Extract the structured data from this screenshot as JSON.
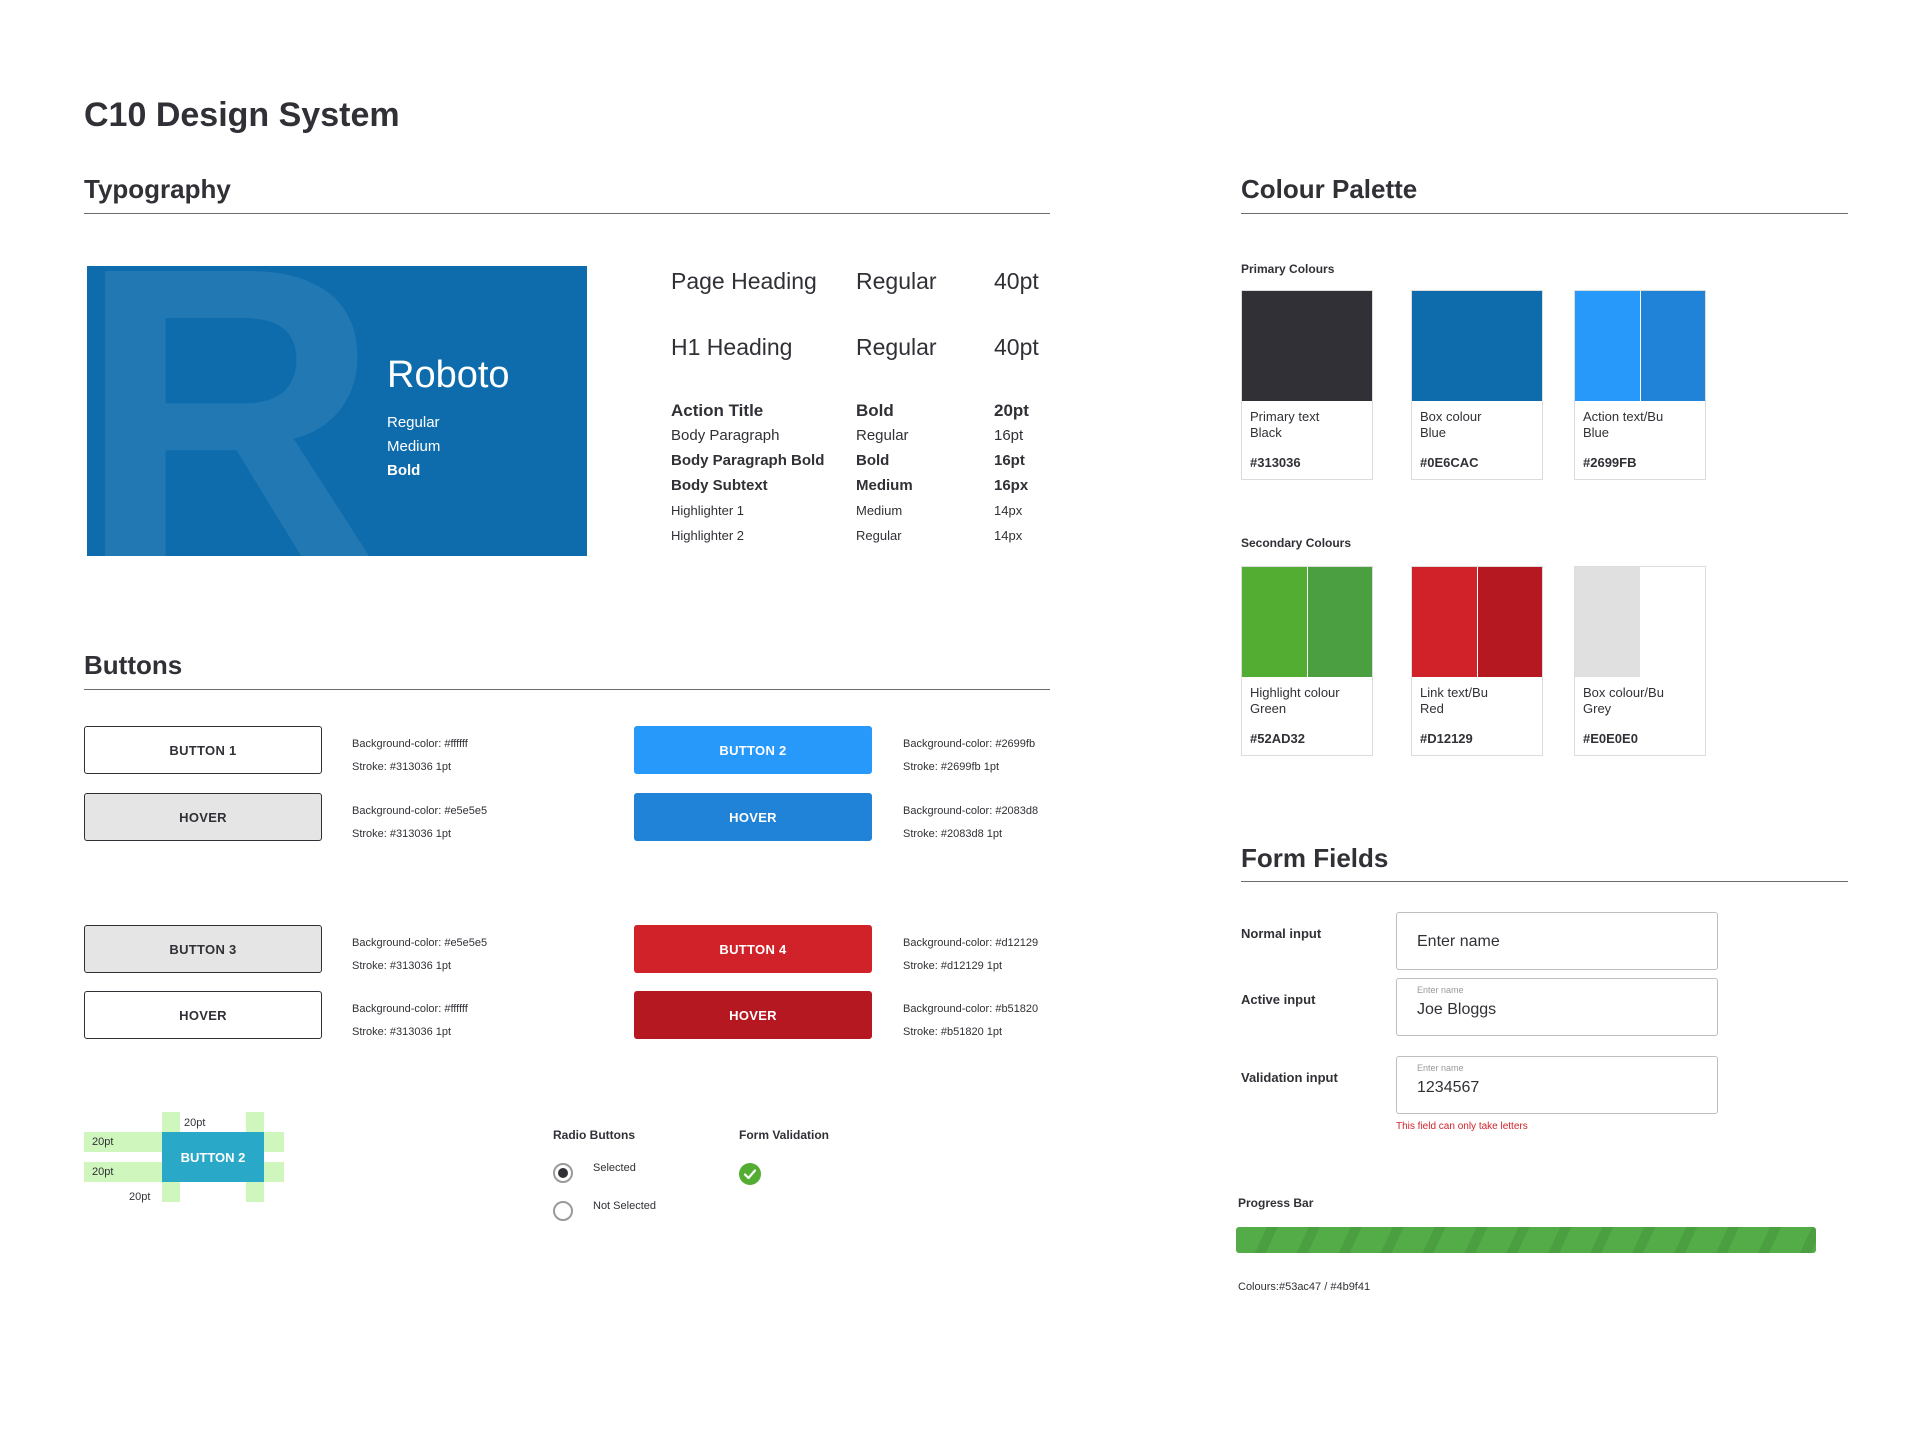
{
  "page_title": "C10 Design System",
  "typography": {
    "title": "Typography",
    "font": {
      "glyph": "R",
      "name": "Roboto",
      "weights": [
        "Regular",
        "Medium",
        "Bold"
      ]
    },
    "rows": [
      {
        "name": "Page Heading",
        "weight": "Regular",
        "size": "40pt"
      },
      {
        "name": "H1 Heading",
        "weight": "Regular",
        "size": "40pt"
      },
      {
        "name": "Action Title",
        "weight": "Bold",
        "size": "20pt"
      },
      {
        "name": "Body Paragraph",
        "weight": "Regular",
        "size": "16pt"
      },
      {
        "name": "Body Paragraph Bold",
        "weight": "Bold",
        "size": "16pt"
      },
      {
        "name": "Body Subtext",
        "weight": "Medium",
        "size": "16px"
      },
      {
        "name": "Highlighter 1",
        "weight": "Medium",
        "size": "14px"
      },
      {
        "name": "Highlighter 2",
        "weight": "Regular",
        "size": "14px"
      }
    ]
  },
  "buttons": {
    "title": "Buttons",
    "items": [
      {
        "label": "BUTTON 1",
        "bg_text": "Background-color: #ffffff",
        "stroke_text": "Stroke: #313036 1pt",
        "bg": "#ffffff",
        "stroke": "#313036",
        "fg": "#313036"
      },
      {
        "label": "HOVER",
        "bg_text": "Background-color: #e5e5e5",
        "stroke_text": "Stroke: #313036 1pt",
        "bg": "#e5e5e5",
        "stroke": "#313036",
        "fg": "#313036"
      },
      {
        "label": "BUTTON 2",
        "bg_text": "Background-color: #2699fb",
        "stroke_text": "Stroke: #2699fb 1pt",
        "bg": "#2699fb",
        "stroke": "#2699fb",
        "fg": "#ffffff"
      },
      {
        "label": "HOVER",
        "bg_text": "Background-color: #2083d8",
        "stroke_text": "Stroke: #2083d8 1pt",
        "bg": "#2083d8",
        "stroke": "#2083d8",
        "fg": "#ffffff"
      },
      {
        "label": "BUTTON 3",
        "bg_text": "Background-color: #e5e5e5",
        "stroke_text": "Stroke: #313036 1pt",
        "bg": "#e5e5e5",
        "stroke": "#313036",
        "fg": "#313036"
      },
      {
        "label": "HOVER",
        "bg_text": "Background-color: #ffffff",
        "stroke_text": "Stroke: #313036 1pt",
        "bg": "#ffffff",
        "stroke": "#313036",
        "fg": "#313036"
      },
      {
        "label": "BUTTON 4",
        "bg_text": "Background-color: #d12129",
        "stroke_text": "Stroke: #d12129 1pt",
        "bg": "#d12129",
        "stroke": "#d12129",
        "fg": "#ffffff"
      },
      {
        "label": "HOVER",
        "bg_text": "Background-color: #b51820",
        "stroke_text": "Stroke: #b51820 1pt",
        "bg": "#b51820",
        "stroke": "#b51820",
        "fg": "#ffffff"
      }
    ],
    "spacing": {
      "button_label": "BUTTON 2",
      "top": "20pt",
      "left": "20pt",
      "right": "20pt",
      "bottom": "20pt"
    }
  },
  "radio": {
    "title": "Radio Buttons",
    "selected": "Selected",
    "not_selected": "Not Selected"
  },
  "validation": {
    "title": "Form Validation",
    "icon": "check-circle-icon",
    "color": "#52AD32"
  },
  "palette": {
    "title": "Colour Palette",
    "primary_label": "Primary Colours",
    "secondary_label": "Secondary Colours",
    "primary": [
      {
        "line1": "Primary text",
        "line2": "Black",
        "hex": "#313036",
        "fill": [
          "#313036"
        ]
      },
      {
        "line1": "Box colour",
        "line2": "Blue",
        "hex": "#0E6CAC",
        "fill": [
          "#0E6CAC"
        ]
      },
      {
        "line1": "Action text/Bu",
        "line2": "Blue",
        "hex": "#2699FB",
        "fill": [
          "#2699FB",
          "#2083D8"
        ]
      }
    ],
    "secondary": [
      {
        "line1": "Highlight colour",
        "line2": "Green",
        "hex": "#52AD32",
        "fill": [
          "#52AD32",
          "#4B9F41"
        ]
      },
      {
        "line1": "Link text/Bu",
        "line2": "Red",
        "hex": "#D12129",
        "fill": [
          "#D12129",
          "#B51820"
        ]
      },
      {
        "line1": "Box colour/Bu",
        "line2": "Grey",
        "hex": "#E0E0E0",
        "fill": [
          "#E0E0E0",
          "#FFFFFF"
        ]
      }
    ]
  },
  "form": {
    "title": "Form Fields",
    "normal": {
      "label": "Normal input",
      "placeholder": "Enter name"
    },
    "active": {
      "label": "Active input",
      "caption": "Enter name",
      "value": "Joe Bloggs"
    },
    "validation": {
      "label": "Validation input",
      "caption": "Enter name",
      "value": "1234567",
      "error": "This field can only take letters"
    },
    "progress": {
      "label": "Progress Bar",
      "colours": "Colours:#53ac47 / #4b9f41",
      "value": 1.0
    }
  }
}
